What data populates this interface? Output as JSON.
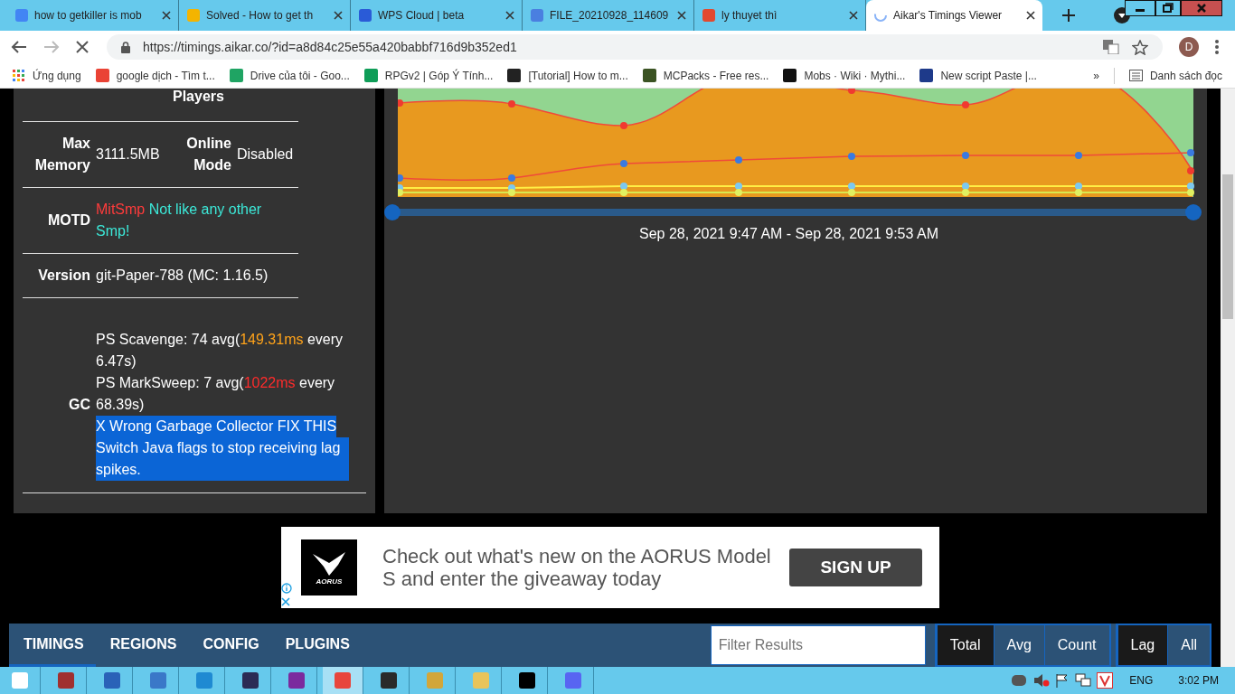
{
  "browser": {
    "tabs": [
      {
        "title": "how to getkiller is mob",
        "selected": false
      },
      {
        "title": "Solved - How to get th",
        "selected": false
      },
      {
        "title": "WPS Cloud | beta",
        "selected": false
      },
      {
        "title": "FILE_20210928_114609",
        "selected": false
      },
      {
        "title": "ly thuyet thì",
        "selected": false
      },
      {
        "title": "Aikar's Timings Viewer",
        "selected": true
      }
    ],
    "url": "https://timings.aikar.co/?id=a8d84c25e55a420babbf716d9b352ed1",
    "profile_initial": "D",
    "bookmarks": [
      "Ứng dụng",
      "google dịch - Tìm t...",
      "Drive của tôi - Goo...",
      "RPGv2 | Góp Ý Tính...",
      "[Tutorial] How to m...",
      "MCPacks - Free res...",
      "Mobs · Wiki · Mythi...",
      "New script Paste |..."
    ],
    "more": "»",
    "reading_list": "Danh sách đọc"
  },
  "server_info": {
    "players_label": "Players",
    "max_memory": {
      "label": "Max Memory",
      "value": "3111.5MB"
    },
    "online_mode": {
      "label": "Online Mode",
      "value": "Disabled"
    },
    "motd": {
      "label": "MOTD",
      "segments": [
        {
          "text": "MitSmp",
          "color": "#ff3b3b"
        },
        {
          "text": "Not like any other Smp!",
          "color": "#3ce8d8"
        }
      ]
    },
    "version": {
      "label": "Version",
      "value": "git-Paper-788 (MC: 1.16.5)"
    },
    "gc": {
      "label": "GC",
      "collectors": [
        {
          "name": "PS Scavenge: 74 avg(",
          "time": "149.31ms",
          "color": "#ffa31a",
          "suffix": "every 6.47s)"
        },
        {
          "name": "PS MarkSweep: 7 avg(",
          "time": "1022ms",
          "color": "#ff2b2b",
          "suffix": "every 68.39s)"
        }
      ],
      "warning": {
        "lines": [
          "X Wrong Garbage Collector FIX THIS",
          "Switch Java flags to stop receiving lag spikes."
        ],
        "highlighted": true
      }
    }
  },
  "chart": {
    "range_slider": {
      "level": 1
    },
    "range_label": "Sep 28, 2021 9:47 AM - Sep 28, 2021 9:53 AM"
  },
  "ad": {
    "logo_text": "AORUS",
    "headline": "Check out what's new on the AORUS Model S and enter the giveaway today",
    "cta": "SIGN UP"
  },
  "nav": {
    "tabs": [
      {
        "label": "TIMINGS",
        "selected": true
      },
      {
        "label": "REGIONS",
        "selected": false
      },
      {
        "label": "CONFIG",
        "selected": false
      },
      {
        "label": "PLUGINS",
        "selected": false
      }
    ],
    "filter": {
      "placeholder": "Filter Results"
    },
    "modes": [
      {
        "label": "Total",
        "selected": true
      },
      {
        "label": "Avg",
        "selected": false
      },
      {
        "label": "Count",
        "selected": false
      }
    ],
    "lag_modes": [
      {
        "label": "Lag",
        "selected": true
      },
      {
        "label": "All",
        "selected": false
      }
    ]
  },
  "taskbar": {
    "language": "ENG",
    "time": "3:02 PM"
  }
}
